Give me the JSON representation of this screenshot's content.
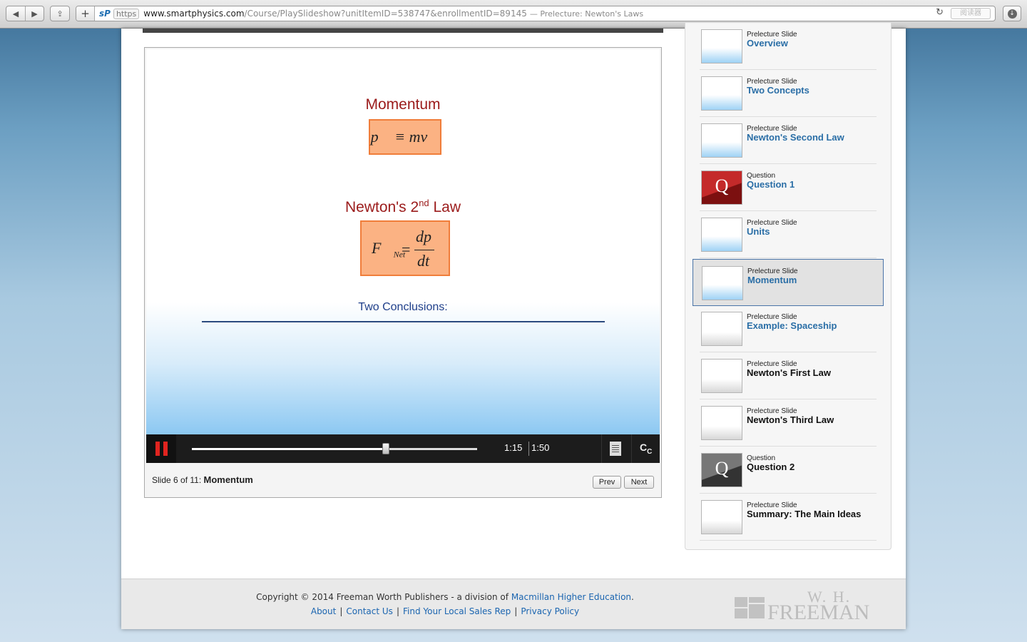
{
  "browser": {
    "url_main": "www.smartphysics.com",
    "url_path": "/Course/PlaySlideshow?unitItemID=538747&enrollmentID=89145",
    "tab_title": "— Prelecture: Newton's Laws",
    "protocol_badge": "https",
    "reader_label": "阅读器"
  },
  "slide": {
    "heading_momentum": "Momentum",
    "formula_momentum": "p⃗ ≡ mv⃗",
    "heading_newton": "Newton's 2",
    "heading_newton_sup": "nd",
    "heading_newton_end": " Law",
    "formula_lhs": "F⃗",
    "formula_lhs_sub": "Net",
    "formula_eq": "=",
    "formula_num": "dp⃗",
    "formula_den": "dt",
    "conclusions": "Two Conclusions:"
  },
  "player": {
    "time_current": "1:15",
    "time_total": "1:50",
    "progress_fraction": 0.68,
    "cc_label": "CC",
    "slide_position": "Slide 6 of 11: ",
    "slide_title": "Momentum",
    "prev_label": "Prev",
    "next_label": "Next"
  },
  "sidebar": {
    "items": [
      {
        "kind": "Prelecture Slide",
        "title": "Overview",
        "thumb": "blue",
        "visited": true
      },
      {
        "kind": "Prelecture Slide",
        "title": "Two Concepts",
        "thumb": "blue",
        "visited": true
      },
      {
        "kind": "Prelecture Slide",
        "title": "Newton's Second Law",
        "thumb": "blue",
        "visited": true
      },
      {
        "kind": "Question",
        "title": "Question 1",
        "thumb": "red",
        "visited": true
      },
      {
        "kind": "Prelecture Slide",
        "title": "Units",
        "thumb": "blue",
        "visited": true
      },
      {
        "kind": "Prelecture Slide",
        "title": "Momentum",
        "thumb": "blue",
        "visited": true,
        "active": true
      },
      {
        "kind": "Prelecture Slide",
        "title": "Example: Spaceship",
        "thumb": "white",
        "visited": true
      },
      {
        "kind": "Prelecture Slide",
        "title": "Newton's First Law",
        "thumb": "white",
        "visited": false
      },
      {
        "kind": "Prelecture Slide",
        "title": "Newton's Third Law",
        "thumb": "white",
        "visited": false
      },
      {
        "kind": "Question",
        "title": "Question 2",
        "thumb": "gray",
        "visited": false
      },
      {
        "kind": "Prelecture Slide",
        "title": "Summary: The Main Ideas",
        "thumb": "white",
        "visited": false
      }
    ]
  },
  "footer": {
    "copyright_prefix": "Copyright © 2014 Freeman Worth Publishers - a division of ",
    "copyright_link": "Macmillan Higher Education",
    "copyright_suffix": ".",
    "links": [
      "About",
      "Contact Us",
      "Find Your Local Sales Rep",
      "Privacy Policy"
    ],
    "logo_top": "W. H.",
    "logo_name": "FREEMAN"
  },
  "colors": {
    "accent_link": "#2a6ea6",
    "slide_heading": "#9b1b1b",
    "formula_fill": "#fbb283",
    "pause_red": "#e0241f"
  }
}
